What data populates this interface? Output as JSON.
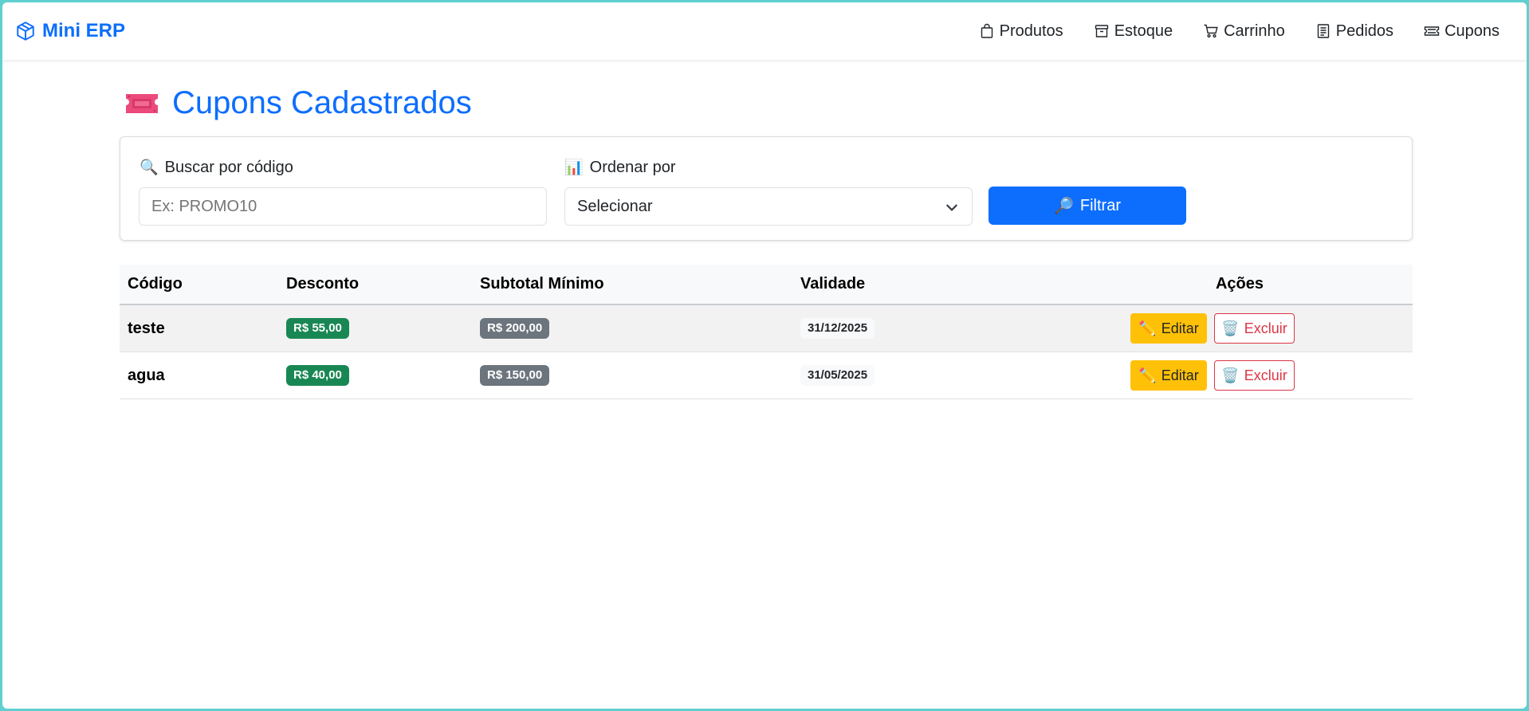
{
  "navbar": {
    "brand": "Mini ERP",
    "brand_icon": "box-icon",
    "items": [
      {
        "label": "Produtos",
        "icon": "bag-icon"
      },
      {
        "label": "Estoque",
        "icon": "archive-icon"
      },
      {
        "label": "Carrinho",
        "icon": "cart-icon"
      },
      {
        "label": "Pedidos",
        "icon": "receipt-icon"
      },
      {
        "label": "Cupons",
        "icon": "ticket-icon"
      }
    ]
  },
  "page": {
    "title": "Cupons Cadastrados",
    "title_icon": "ticket-emoji-icon"
  },
  "filters": {
    "search_label": "Buscar por código",
    "search_emoji": "🔍",
    "search_placeholder": "Ex: PROMO10",
    "search_value": "",
    "sort_label": "Ordenar por",
    "sort_emoji": "📊",
    "sort_value": "Selecionar",
    "filter_emoji": "🔎",
    "filter_button": "Filtrar"
  },
  "table": {
    "headers": [
      "Código",
      "Desconto",
      "Subtotal Mínimo",
      "Validade",
      "Ações"
    ],
    "rows": [
      {
        "code": "teste",
        "discount": "R$ 55,00",
        "min_subtotal": "R$ 200,00",
        "validity": "31/12/2025",
        "edit": "Editar",
        "delete": "Excluir"
      },
      {
        "code": "agua",
        "discount": "R$ 40,00",
        "min_subtotal": "R$ 150,00",
        "validity": "31/05/2025",
        "edit": "Editar",
        "delete": "Excluir"
      }
    ]
  },
  "colors": {
    "primary": "#0d6efd",
    "success": "#198754",
    "secondary": "#6c757d",
    "warning": "#ffc107",
    "danger": "#dc3545",
    "border": "#5fcfcf"
  }
}
